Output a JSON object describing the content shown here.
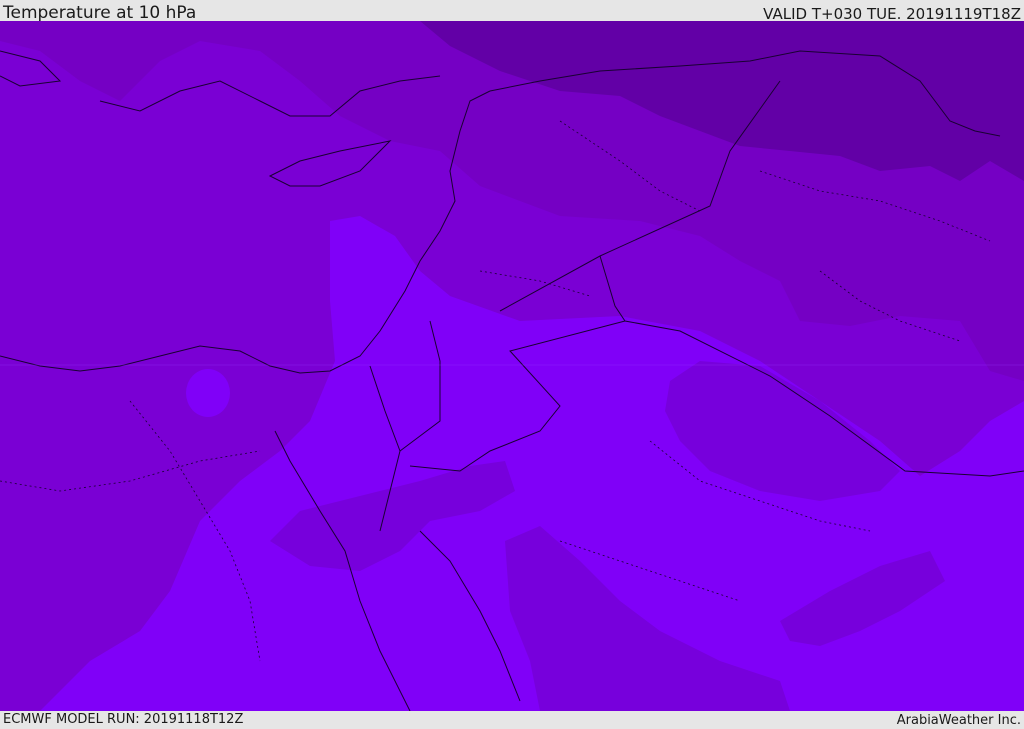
{
  "header": {
    "title": "Temperature at 10 hPa",
    "valid_time": "VALID T+030 TUE. 20191119T18Z"
  },
  "footer": {
    "model_run": "ECMWF MODEL RUN: 20191118T12Z",
    "credit": "ArabiaWeather Inc."
  },
  "map": {
    "colors": {
      "band_darkest": "#5e00a0",
      "band_dark": "#7400be",
      "band_mid": "#7b00d8",
      "band_light": "#8200ff",
      "boundary_line": "#1a0033"
    }
  }
}
